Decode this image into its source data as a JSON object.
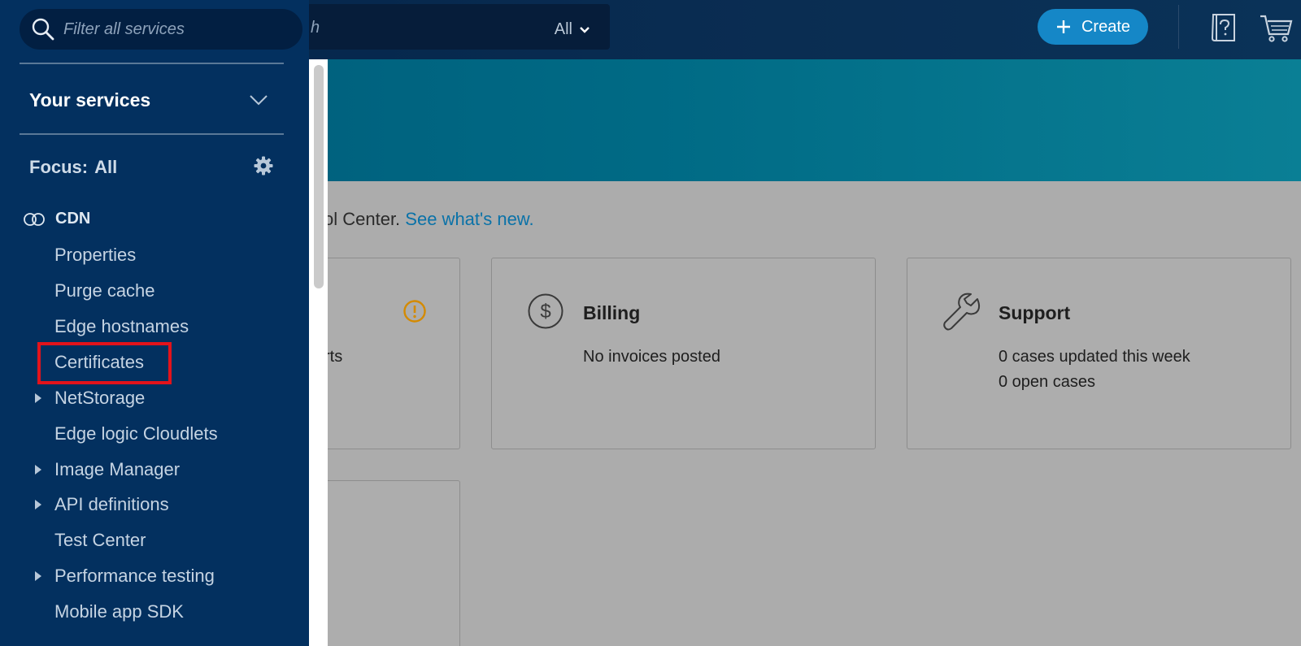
{
  "topbar": {
    "search_placeholder_fragment": "h",
    "search_scope": "All",
    "create_label": "Create"
  },
  "main": {
    "welcome_fragment": "ol Center.",
    "welcome_link": "See what's new.",
    "cards": {
      "alerts_fragment": "rts",
      "billing": {
        "title": "Billing",
        "line1": "No invoices posted"
      },
      "support": {
        "title": "Support",
        "line1": "0 cases updated this week",
        "line2": "0 open cases"
      }
    }
  },
  "sidenav": {
    "filter_placeholder": "Filter all services",
    "your_services": "Your services",
    "focus_label": "Focus:",
    "focus_value": "All",
    "group": "CDN",
    "items": [
      {
        "label": "Properties"
      },
      {
        "label": "Purge cache"
      },
      {
        "label": "Edge hostnames"
      },
      {
        "label": "Certificates"
      },
      {
        "label": "NetStorage"
      },
      {
        "label": "Edge logic Cloudlets"
      },
      {
        "label": "Image Manager"
      },
      {
        "label": "API definitions"
      },
      {
        "label": "Test Center"
      },
      {
        "label": "Performance testing"
      },
      {
        "label": "Mobile app SDK"
      }
    ],
    "highlighted_item": "Certificates"
  },
  "colors": {
    "nav_bg": "#03305f",
    "create_btn": "#1587c7",
    "highlight": "#e3131b",
    "link": "#0a72a8",
    "warning": "#d48a00"
  },
  "icons": [
    "search-icon",
    "chevron-down-icon",
    "plus-icon",
    "help-book-icon",
    "cart-icon",
    "gear-icon",
    "cdn-icon",
    "caret-right-icon",
    "warning-icon",
    "dollar-icon",
    "wrench-icon"
  ]
}
